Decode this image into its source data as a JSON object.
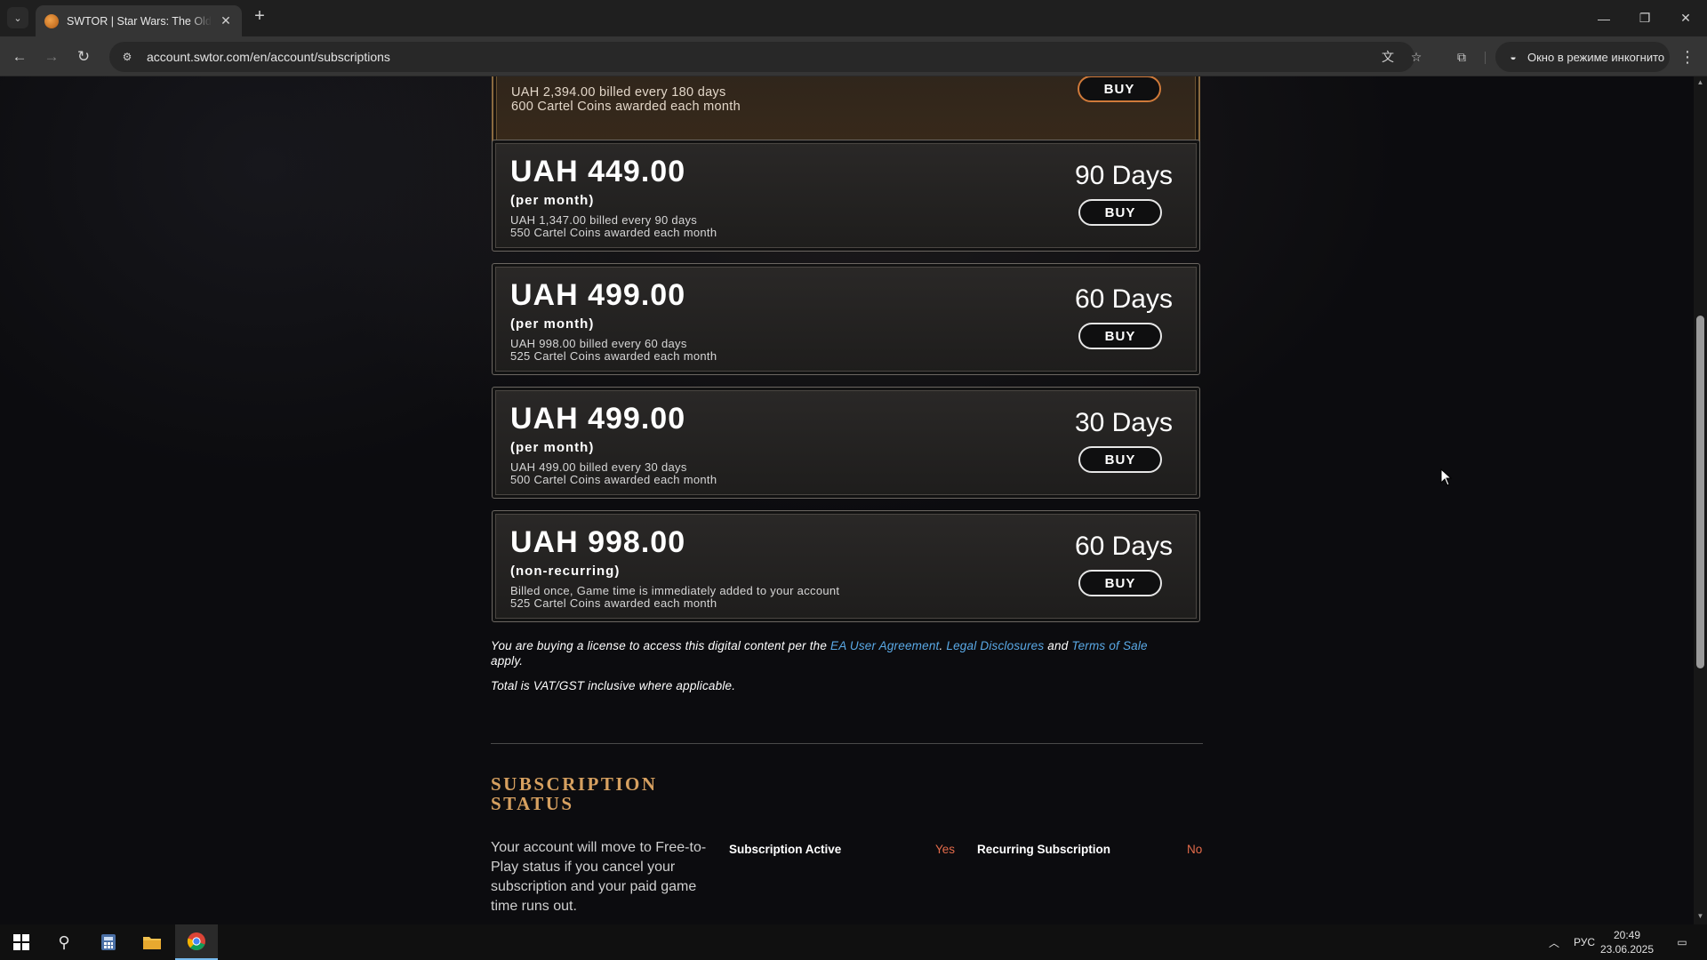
{
  "browser": {
    "tab_title": "SWTOR | Star Wars: The Old Republic",
    "url": "account.swtor.com/en/account/subscriptions",
    "incognito_label": "Окно в режиме инкогнито"
  },
  "plans": [
    {
      "line1": "UAH 2,394.00 billed every 180 days",
      "line2": "600 Cartel Coins awarded each month",
      "buy": "BUY"
    },
    {
      "price": "UAH 449.00",
      "term": "(per month)",
      "line1": "UAH 1,347.00 billed every 90 days",
      "line2": "550 Cartel Coins awarded each month",
      "days": "90 Days",
      "buy": "BUY"
    },
    {
      "price": "UAH 499.00",
      "term": "(per month)",
      "line1": "UAH 998.00 billed every 60 days",
      "line2": "525 Cartel Coins awarded each month",
      "days": "60 Days",
      "buy": "BUY"
    },
    {
      "price": "UAH 499.00",
      "term": "(per month)",
      "line1": "UAH 499.00 billed every 30 days",
      "line2": "500 Cartel Coins awarded each month",
      "days": "30 Days",
      "buy": "BUY"
    },
    {
      "price": "UAH 998.00",
      "term": "(non-recurring)",
      "line1": "Billed once, Game time is immediately added to your account",
      "line2": "525 Cartel Coins awarded each month",
      "days": "60 Days",
      "buy": "BUY"
    }
  ],
  "legal": {
    "prefix": "You are buying a license to access this digital content per the",
    "link1": "EA User Agreement",
    "sep": ".",
    "link2": "Legal Disclosures",
    "and": "and",
    "link3": "Terms of Sale",
    "suffix": "apply.",
    "vat": "Total is VAT/GST inclusive where applicable."
  },
  "status": {
    "heading": "SUBSCRIPTION STATUS",
    "description": "Your account will move to Free-to-Play status if you cancel your subscription and your paid game time runs out.",
    "active_label": "Subscription Active",
    "active_value": "Yes",
    "recurring_label": "Recurring Subscription",
    "recurring_value": "No"
  },
  "taskbar": {
    "lang": "РУС",
    "time": "20:49",
    "date": "23.06.2025"
  },
  "colors": {
    "accent_gold": "#d6a060",
    "link_blue": "#5aa9e6",
    "status_value": "#e46b4a"
  }
}
